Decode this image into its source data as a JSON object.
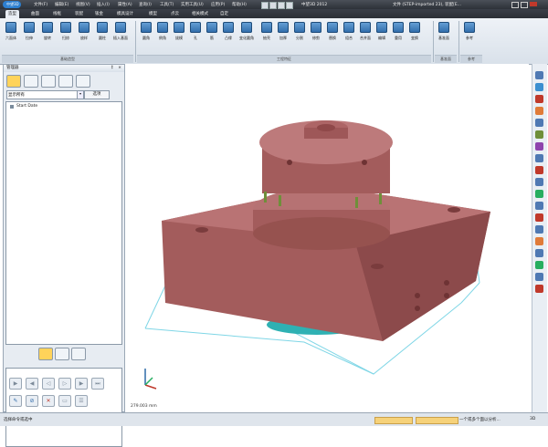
{
  "app": {
    "logo_text": "中望3D",
    "title": "中望3D 2012",
    "document": "文件 (STEP-imported 23), 装配[E..."
  },
  "menu": [
    "文件(F)",
    "编辑(E)",
    "视图(V)",
    "插入(I)",
    "属性(A)",
    "查询(I)",
    "工具(T)",
    "实用工具(U)",
    "应用(P)",
    "帮助(H)"
  ],
  "tabs": [
    "造型",
    "曲面",
    "线框",
    "装配",
    "钣金",
    "模具设计",
    "模型",
    "点云",
    "相关模式",
    "自定"
  ],
  "ribbon": {
    "groups": [
      {
        "label": "基础造型",
        "buttons": [
          "六面体",
          "拉伸",
          "旋转",
          "扫掠",
          "放样",
          "圆柱",
          "插入基面"
        ]
      },
      {
        "label": "工程特征",
        "buttons": [
          "圆角",
          "倒角",
          "拔模",
          "孔",
          "筋",
          "凸缘",
          "变化圆角",
          "抽壳",
          "加厚",
          "分割",
          "修剪",
          "替换",
          "组合",
          "合并面",
          "编辑",
          "重用",
          "变换",
          "布尔",
          "组合面"
        ]
      },
      {
        "label": "基准面",
        "buttons": [
          "基准面"
        ]
      },
      {
        "label": "参考",
        "buttons": [
          "参考"
        ]
      }
    ]
  },
  "left_panel": {
    "title": "管理器",
    "filter_value": "显示所有",
    "options_button": "选项",
    "tree_root": "Start Date"
  },
  "viewport": {
    "coordinate_readout": "279.003 mm"
  },
  "statusbar": {
    "prompt": "选择命令或选中",
    "right_field": "一个或多个面以分析...",
    "mode": "3D"
  },
  "colors": {
    "accent": "#2e6aa8",
    "part": "#a35c5c",
    "base": "#2fb1b3",
    "bbox": "#7fd6e6"
  }
}
